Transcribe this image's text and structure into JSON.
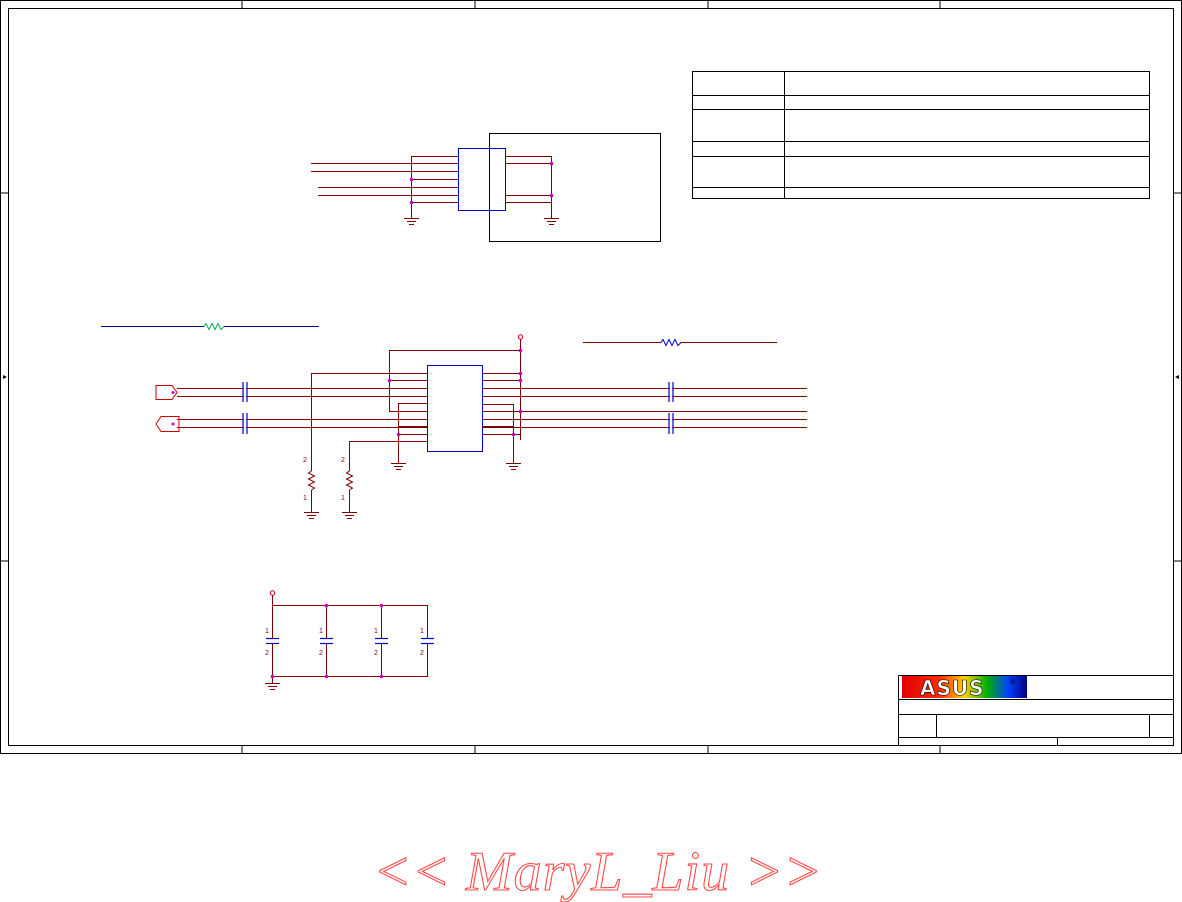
{
  "sheet": {
    "component_pin_labels": {
      "left_resistor": [
        "2",
        "1"
      ],
      "right_resistor": [
        "2",
        "1"
      ],
      "decoupling_caps": [
        "1",
        "2"
      ]
    }
  },
  "title_block": {
    "logo_text": "ASUS",
    "logo_mark": "®"
  },
  "watermark": {
    "text": "<< MaryL_Liu >>"
  },
  "colors": {
    "frame": "#000000",
    "wire": "#800000",
    "component": "#0000cc",
    "connector": "#cc0000",
    "junction": "#cc00cc",
    "resistor_alt": "#00b050",
    "watermark": "#ff4a4a"
  }
}
